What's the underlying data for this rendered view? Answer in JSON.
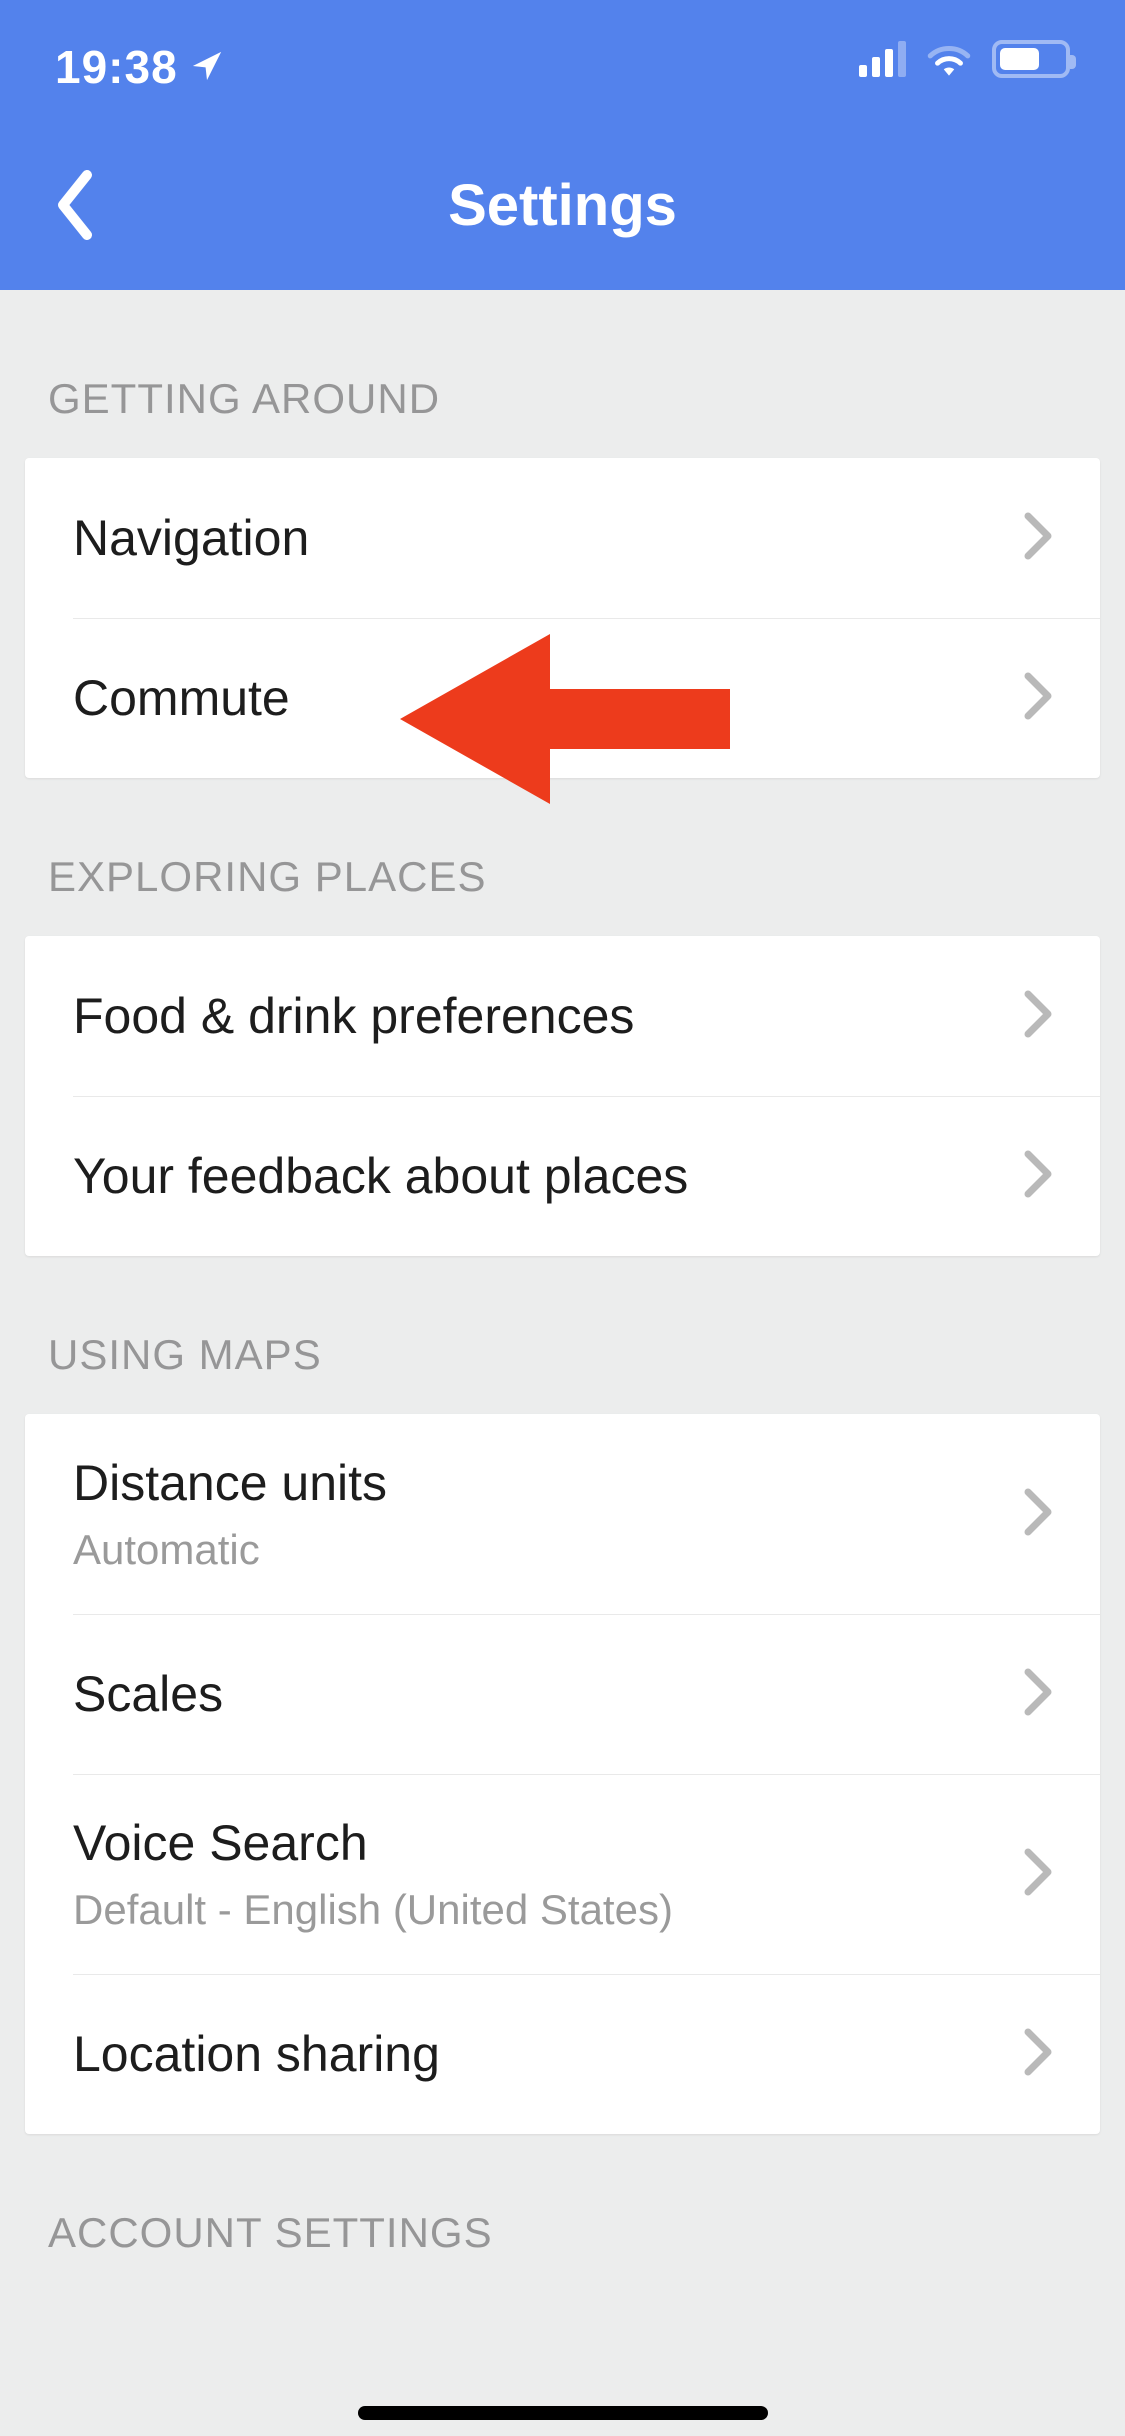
{
  "statusbar": {
    "time": "19:38"
  },
  "header": {
    "title": "Settings"
  },
  "sections": {
    "getting_around": {
      "title": "Getting Around",
      "items": [
        {
          "label": "Navigation"
        },
        {
          "label": "Commute"
        }
      ]
    },
    "exploring_places": {
      "title": "Exploring Places",
      "items": [
        {
          "label": "Food & drink preferences"
        },
        {
          "label": "Your feedback about places"
        }
      ]
    },
    "using_maps": {
      "title": "Using Maps",
      "items": [
        {
          "label": "Distance units",
          "sub": "Automatic"
        },
        {
          "label": "Scales"
        },
        {
          "label": "Voice Search",
          "sub": "Default - English (United States)"
        },
        {
          "label": "Location sharing"
        }
      ]
    },
    "account_settings": {
      "title": "Account Settings"
    }
  }
}
